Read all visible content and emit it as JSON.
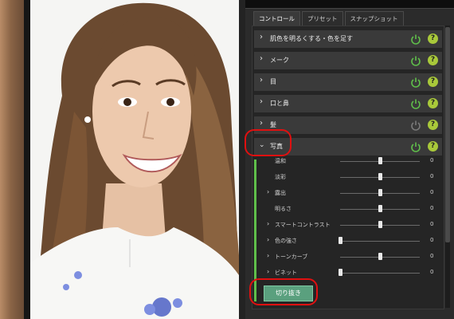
{
  "tabs": [
    {
      "label": "コントロール",
      "active": true
    },
    {
      "label": "プリセット",
      "active": false
    },
    {
      "label": "スナップショット",
      "active": false
    }
  ],
  "sections": [
    {
      "label": "肌色を明るくする・色を足す",
      "power_on": true
    },
    {
      "label": "メーク",
      "power_on": true
    },
    {
      "label": "目",
      "power_on": true
    },
    {
      "label": "口と鼻",
      "power_on": true
    },
    {
      "label": "髪",
      "power_on": false
    },
    {
      "label": "写真",
      "power_on": true,
      "expanded": true
    }
  ],
  "photo_sliders": [
    {
      "label": "温和",
      "expandable": false,
      "value": "0",
      "level": 0.5
    },
    {
      "label": "淡彩",
      "expandable": false,
      "value": "0",
      "level": 0.5
    },
    {
      "label": "露出",
      "expandable": true,
      "value": "0",
      "level": 0.5
    },
    {
      "label": "明るさ",
      "expandable": false,
      "value": "0",
      "level": 0.5
    },
    {
      "label": "スマートコントラスト",
      "expandable": true,
      "value": "0",
      "level": 0.5
    },
    {
      "label": "色の強さ",
      "expandable": true,
      "value": "0",
      "level": 0.0
    },
    {
      "label": "トーンカーブ",
      "expandable": true,
      "value": "0",
      "level": 0.5
    },
    {
      "label": "ビネット",
      "expandable": true,
      "value": "0",
      "level": 0.0
    }
  ],
  "crop_button": {
    "label": "切り抜き"
  },
  "help_symbol": "?",
  "colors": {
    "accent_green": "#5fbf4a",
    "help_badge": "#a9c93a",
    "crop_button": "#5aa07e",
    "annotation_red": "#e01010"
  },
  "icons": {
    "power": "power-icon",
    "help": "help-icon",
    "collapsed": "chevron-right-icon",
    "expanded": "chevron-down-icon"
  }
}
